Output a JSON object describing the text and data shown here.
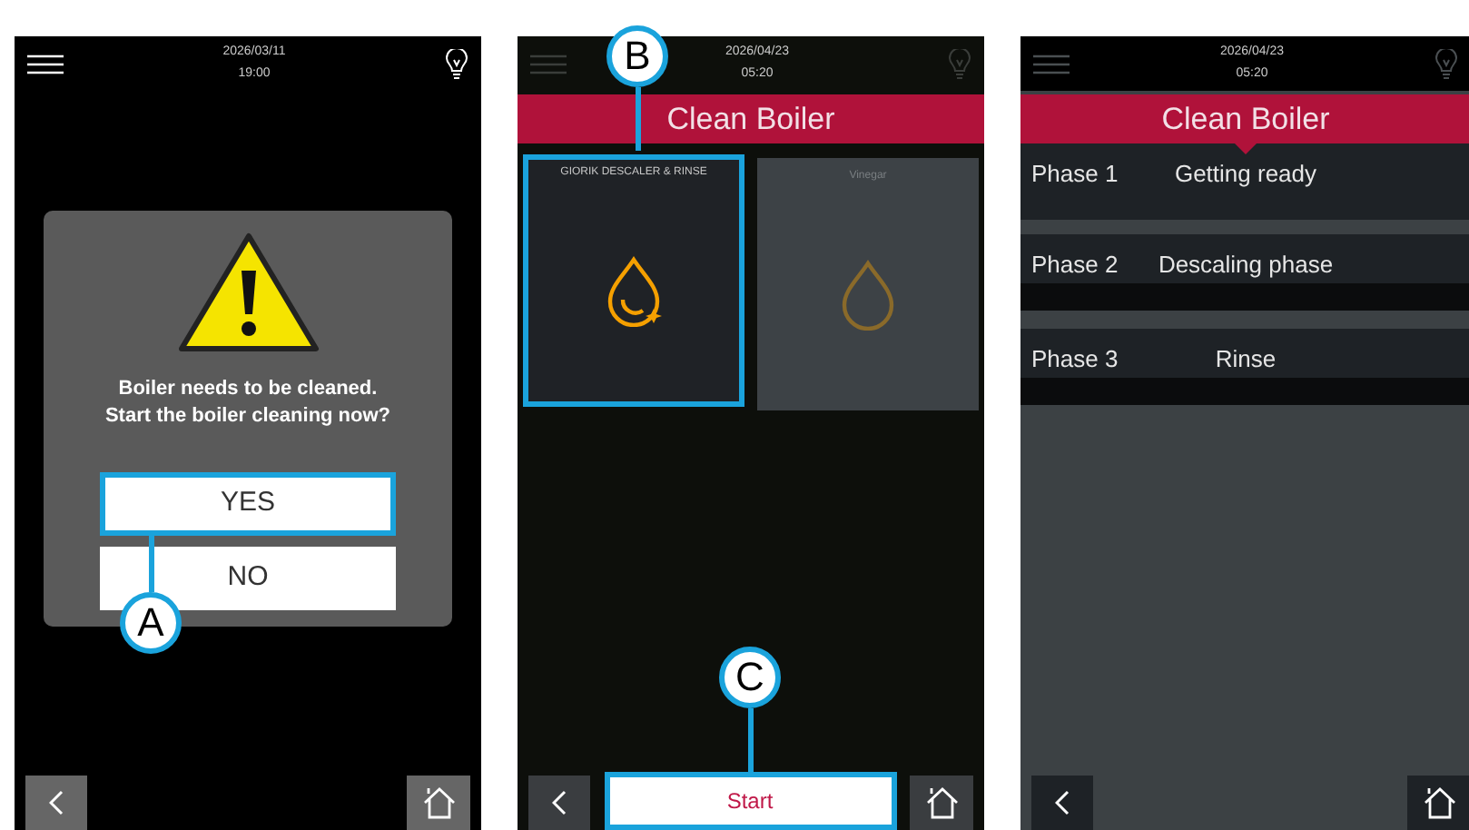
{
  "screens": [
    {
      "kind": "dialog",
      "date": "2026/03/11",
      "time": "19:00",
      "message": "Boiler needs to be cleaned.\nStart the boiler cleaning now?",
      "buttons": [
        {
          "label": "YES",
          "highlighted": true,
          "callout": "A"
        },
        {
          "label": "NO",
          "highlighted": false
        }
      ]
    },
    {
      "kind": "options",
      "date": "2026/04/23",
      "time": "05:20",
      "title": "Clean Boiler",
      "options": [
        {
          "kind": "descaler",
          "label": "GIORIK DESCALER & RINSE",
          "selected": true,
          "callout": "B"
        },
        {
          "kind": "plain",
          "label": "Vinegar",
          "selected": false
        }
      ],
      "start_button": {
        "label": "Start",
        "highlighted": true,
        "callout": "C"
      }
    },
    {
      "kind": "phases",
      "date": "2026/04/23",
      "time": "05:20",
      "title": "Clean Boiler",
      "phases": [
        {
          "label": "Phase 1",
          "name": "Getting ready",
          "active": true
        },
        {
          "label": "Phase 2",
          "name": "Descaling phase",
          "active": false
        },
        {
          "label": "Phase 3",
          "name": "Rinse",
          "active": false
        }
      ]
    }
  ]
}
